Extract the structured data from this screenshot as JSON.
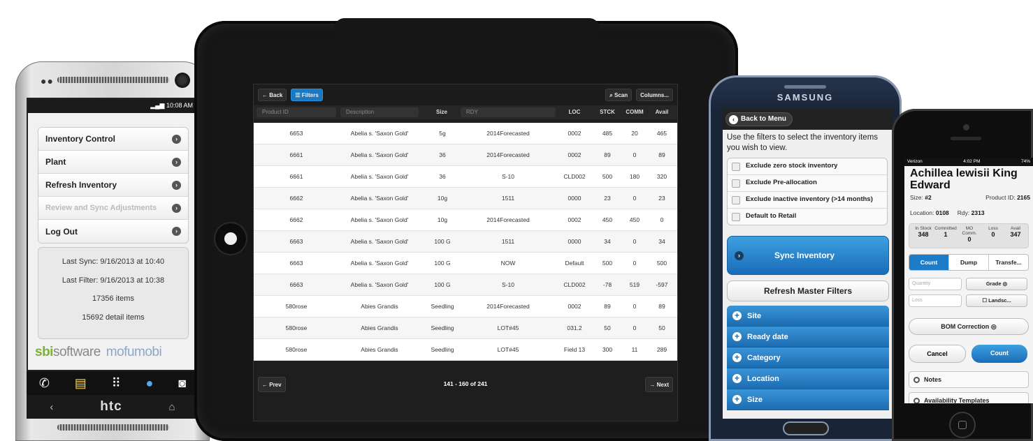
{
  "htc": {
    "status_time": "10:08",
    "status_ampm": "AM",
    "menu": [
      {
        "label": "Inventory Control",
        "enabled": true
      },
      {
        "label": "Plant",
        "enabled": true
      },
      {
        "label": "Refresh Inventory",
        "enabled": true
      },
      {
        "label": "Review and Sync Adjustments",
        "enabled": false
      },
      {
        "label": "Log Out",
        "enabled": true
      }
    ],
    "info": {
      "last_sync": "Last Sync: 9/16/2013 at 10:40",
      "last_filter": "Last Filter: 9/16/2013 at 10:38",
      "items": "17356 items",
      "detail_items": "15692 detail items"
    },
    "logo_sbi": "sbi",
    "logo_software": "software",
    "logo_mofumobi": "mofumobi",
    "brand": "htc"
  },
  "tablet": {
    "back_label": "Back",
    "filters_label": "Filters",
    "scan_label": "Scan",
    "columns_label": "Columns...",
    "headers": {
      "product_id": "Product ID",
      "description": "Description",
      "size": "Size",
      "rdy": "RDY",
      "loc": "LOC",
      "stck": "STCK",
      "comm": "COMM",
      "avail": "Avail"
    },
    "rows": [
      [
        "6653",
        "Abelia s. 'Saxon Gold'",
        "5g",
        "2014Forecasted",
        "0002",
        "485",
        "20",
        "465"
      ],
      [
        "6661",
        "Abelia s. 'Saxon Gold'",
        "36",
        "2014Forecasted",
        "0002",
        "89",
        "0",
        "89"
      ],
      [
        "6661",
        "Abelia s. 'Saxon Gold'",
        "36",
        "S-10",
        "CLD002",
        "500",
        "180",
        "320"
      ],
      [
        "6662",
        "Abelia s. 'Saxon Gold'",
        "10g",
        "1511",
        "0000",
        "23",
        "0",
        "23"
      ],
      [
        "6662",
        "Abelia s. 'Saxon Gold'",
        "10g",
        "2014Forecasted",
        "0002",
        "450",
        "450",
        "0"
      ],
      [
        "6663",
        "Abelia s. 'Saxon Gold'",
        "100 G",
        "1511",
        "0000",
        "34",
        "0",
        "34"
      ],
      [
        "6663",
        "Abelia s. 'Saxon Gold'",
        "100 G",
        "NOW",
        "Default",
        "500",
        "0",
        "500"
      ],
      [
        "6663",
        "Abelia s. 'Saxon Gold'",
        "100 G",
        "S-10",
        "CLD002",
        "-78",
        "519",
        "-597"
      ],
      [
        "580rose",
        "Abies Grandis",
        "Seedling",
        "2014Forecasted",
        "0002",
        "89",
        "0",
        "89"
      ],
      [
        "580rose",
        "Abies Grandis",
        "Seedling",
        "LOT#45",
        "031.2",
        "50",
        "0",
        "50"
      ],
      [
        "580rose",
        "Abies Grandis",
        "Seedling",
        "LOT#45",
        "Field 13",
        "300",
        "11",
        "289"
      ]
    ],
    "prev_label": "Prev",
    "next_label": "Next",
    "page_info": "141 - 160 of 241"
  },
  "samsung": {
    "brand": "SAMSUNG",
    "back_label": "Back to Menu",
    "intro": "Use the filters to select the inventory items you wish to view.",
    "filters": [
      "Exclude zero stock inventory",
      "Exclude Pre-allocation",
      "Exclude inactive inventory (>14 months)",
      "Default to Retail"
    ],
    "sync_label": "Sync Inventory",
    "refresh_label": "Refresh Master Filters",
    "sections": [
      "Site",
      "Ready date",
      "Category",
      "Location",
      "Size"
    ]
  },
  "iphone": {
    "carrier": "Verizon",
    "time": "4:02 PM",
    "battery": "74%",
    "title": "Achillea lewisii King Edward",
    "size_label": "Size:",
    "size_value": "#2",
    "product_label": "Product ID:",
    "product_value": "2165",
    "location_label": "Location:",
    "location_value": "0108",
    "rdy_label": "Rdy:",
    "rdy_value": "2313",
    "stock": [
      {
        "label": "In Stock",
        "value": "348"
      },
      {
        "label": "Committed",
        "value": "1"
      },
      {
        "label": "MO Comm.",
        "value": "0"
      },
      {
        "label": "Loss",
        "value": "0"
      },
      {
        "label": "Avail",
        "value": "347"
      }
    ],
    "segments": [
      "Count",
      "Dump",
      "Transfe..."
    ],
    "quantity_placeholder": "Quantity",
    "loss_placeholder": "Loss",
    "grade_label": "Grade",
    "landsc_label": "Landsc...",
    "bom_label": "BOM Correction",
    "cancel_label": "Cancel",
    "count_label": "Count",
    "notes_label": "Notes",
    "avail_templates_label": "Availability Templates"
  }
}
